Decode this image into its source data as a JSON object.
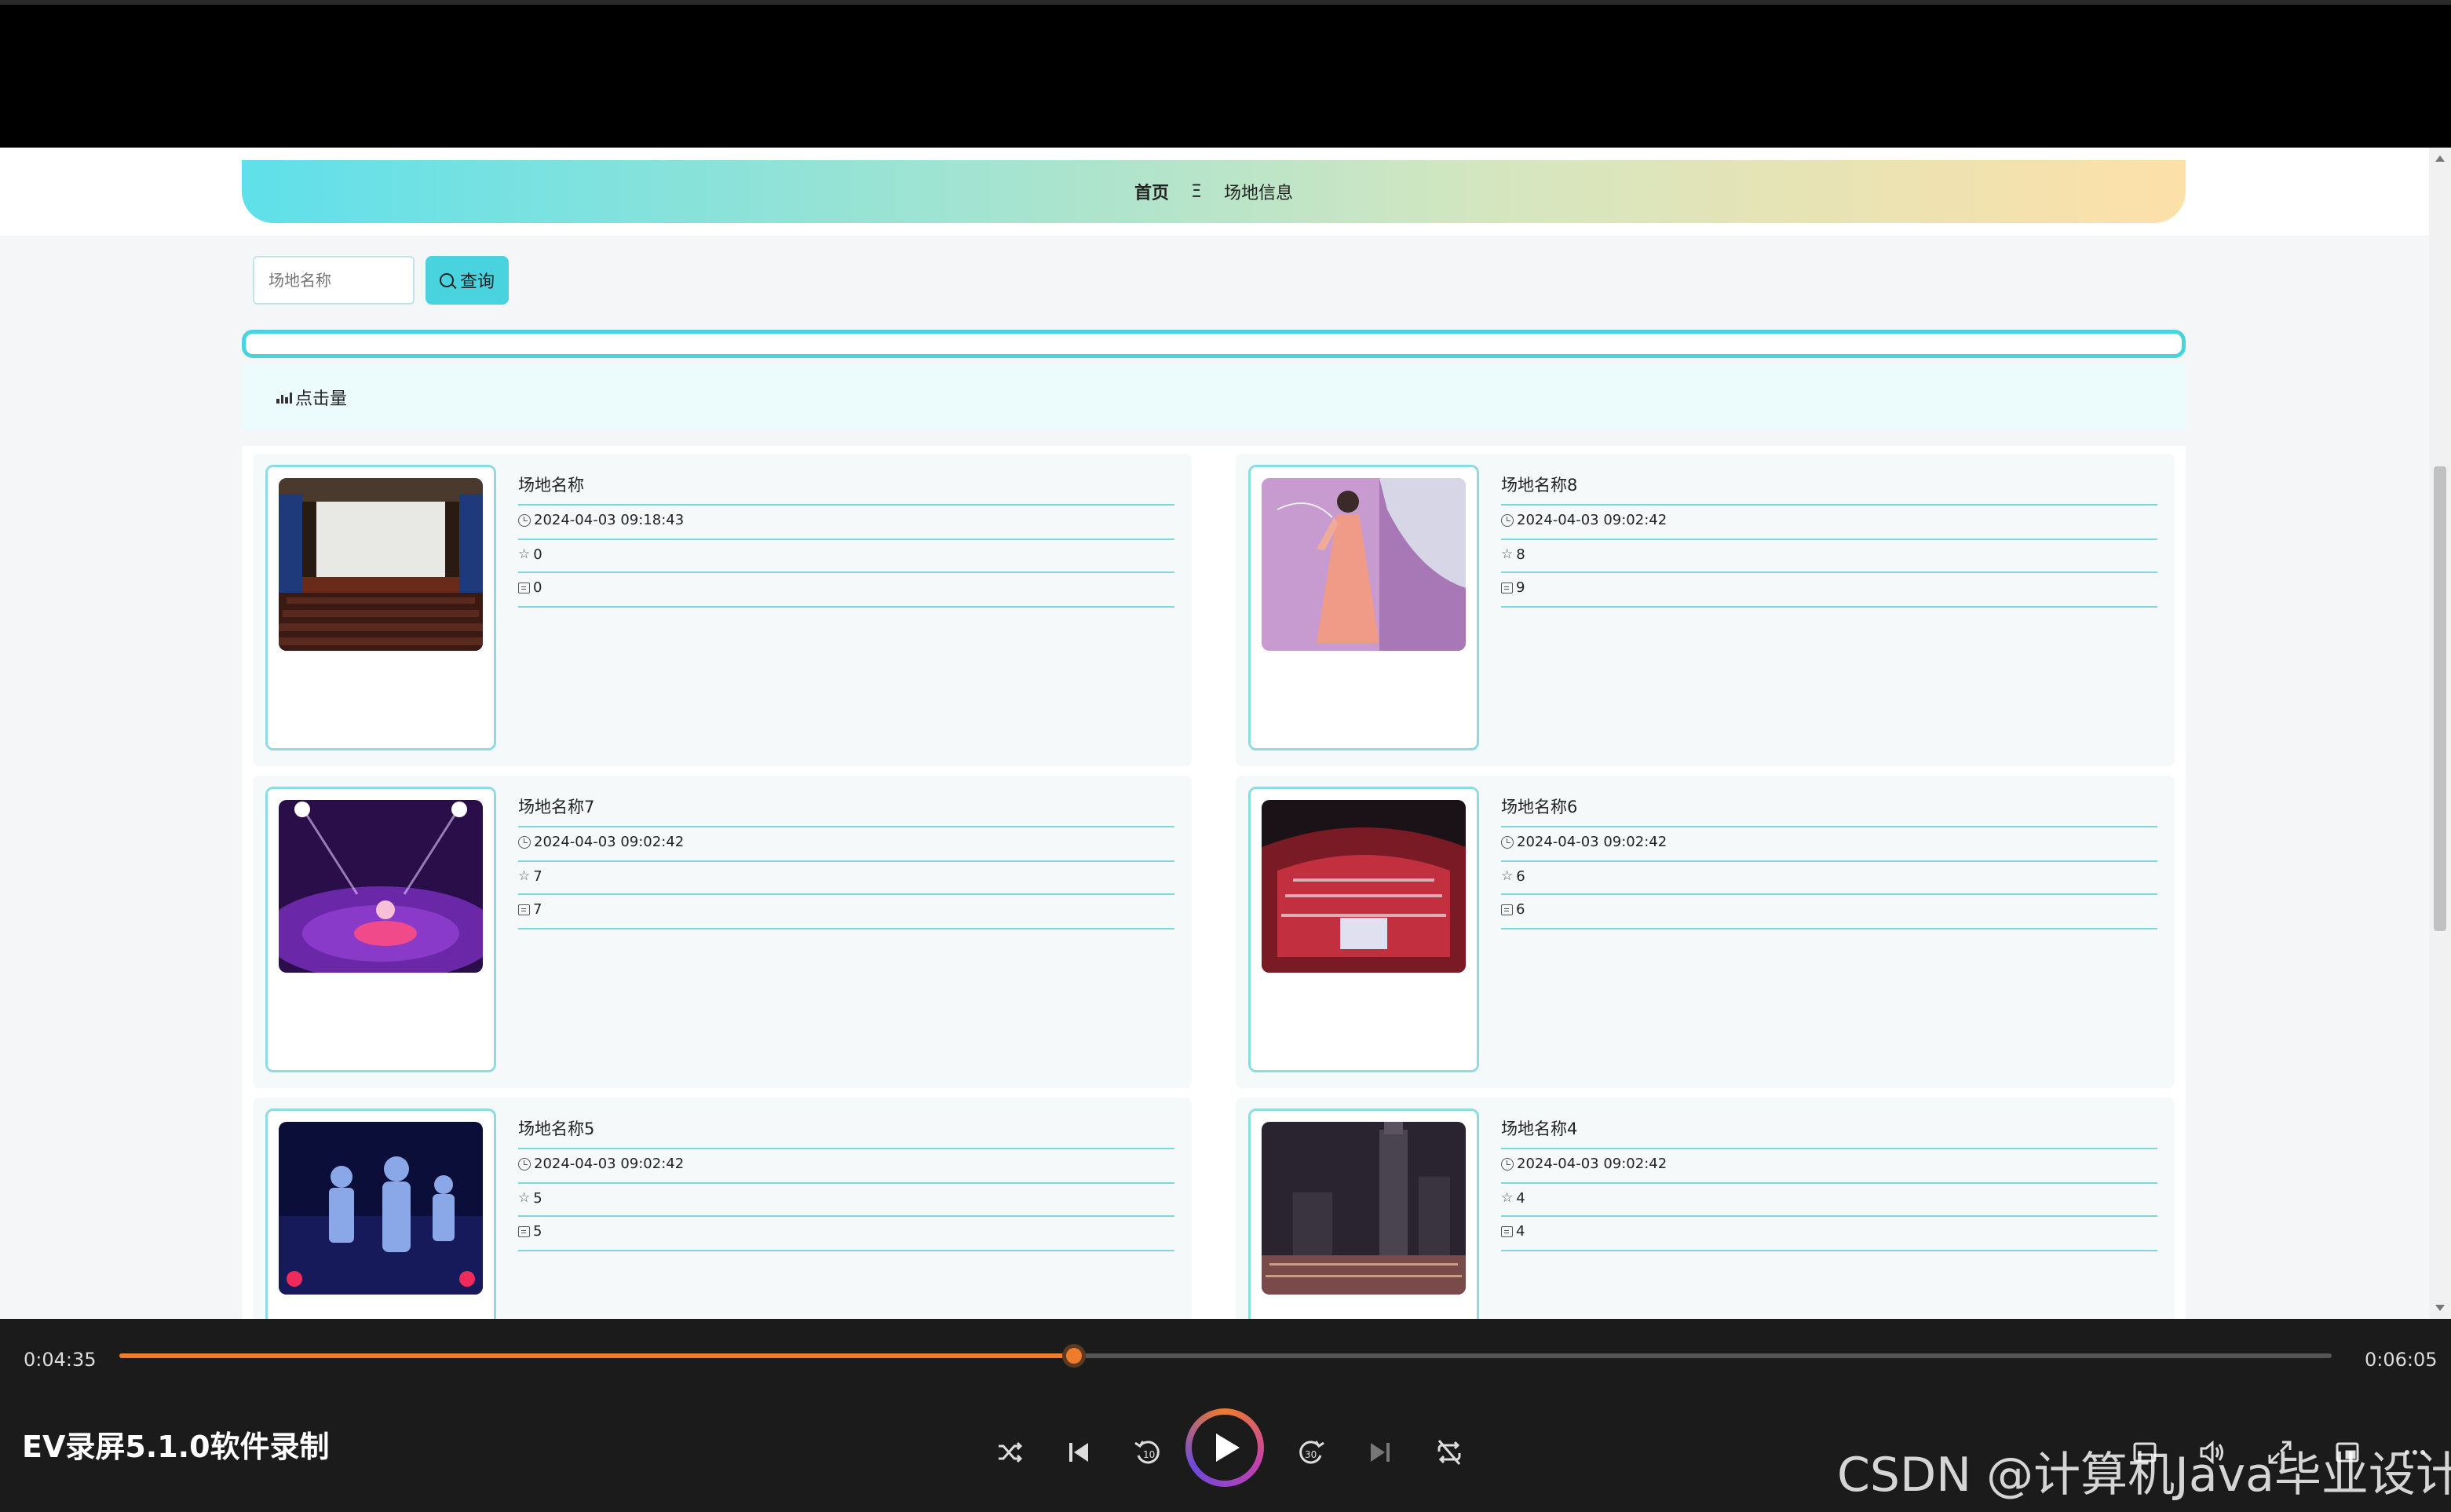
{
  "breadcrumb": {
    "home": "首页",
    "separator": "Ξ",
    "current": "场地信息"
  },
  "search": {
    "placeholder": "场地名称",
    "button_label": "查询"
  },
  "sort": {
    "label": "点击量"
  },
  "venues": [
    {
      "title": "场地名称",
      "time": "2024-04-03 09:18:43",
      "likes": "0",
      "comments": "0"
    },
    {
      "title": "场地名称8",
      "time": "2024-04-03 09:02:42",
      "likes": "8",
      "comments": "9"
    },
    {
      "title": "场地名称7",
      "time": "2024-04-03 09:02:42",
      "likes": "7",
      "comments": "7"
    },
    {
      "title": "场地名称6",
      "time": "2024-04-03 09:02:42",
      "likes": "6",
      "comments": "6"
    },
    {
      "title": "场地名称5",
      "time": "2024-04-03 09:02:42",
      "likes": "5",
      "comments": "5"
    },
    {
      "title": "场地名称4",
      "time": "2024-04-03 09:02:42",
      "likes": "4",
      "comments": "4"
    }
  ],
  "player": {
    "current_time": "0:04:35",
    "total_time": "0:06:05",
    "progress": 0.4315,
    "title": "EV录屏5.1.0软件录制",
    "watermark": "CSDN @计算机Java毕业设计",
    "accent_color": "#f07b2a"
  },
  "colors": {
    "accent": "#49d3de",
    "divider": "#7fd6e0"
  }
}
